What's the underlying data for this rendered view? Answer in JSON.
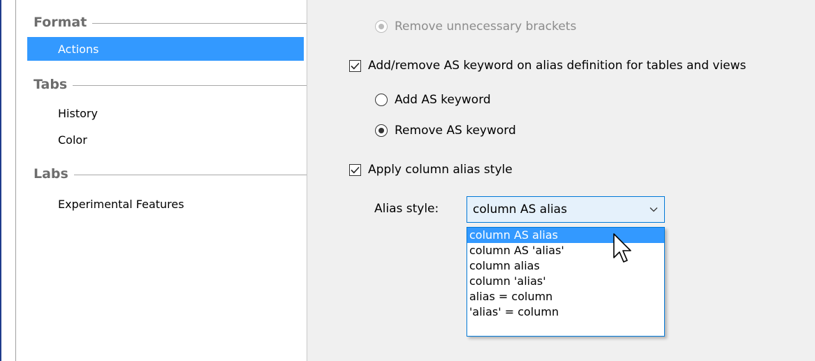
{
  "sidebar": {
    "sections": [
      {
        "title": "Format",
        "items": [
          {
            "label": "Actions",
            "selected": true
          }
        ]
      },
      {
        "title": "Tabs",
        "items": [
          {
            "label": "History",
            "selected": false
          },
          {
            "label": "Color",
            "selected": false
          }
        ]
      },
      {
        "title": "Labs",
        "items": [
          {
            "label": "Experimental Features",
            "selected": false
          }
        ]
      }
    ]
  },
  "content": {
    "remove_brackets": {
      "label": "Remove unnecessary brackets",
      "checked": true,
      "enabled": false
    },
    "as_keyword": {
      "label": "Add/remove AS keyword on alias definition for tables and views",
      "checked": true,
      "options": [
        {
          "label": "Add AS keyword",
          "selected": false
        },
        {
          "label": "Remove AS keyword",
          "selected": true
        }
      ]
    },
    "column_alias": {
      "label": "Apply column alias style",
      "checked": true
    },
    "alias_style": {
      "label": "Alias style:",
      "value": "column AS alias",
      "options": [
        "column AS alias",
        "column AS 'alias'",
        "column alias",
        "column 'alias'",
        "alias = column",
        "'alias' = column"
      ],
      "highlighted_index": 0
    }
  },
  "icons": {
    "checkbox_check": "check-icon",
    "combo_chevron": "chevron-down-icon",
    "cursor": "mouse-pointer-icon"
  },
  "colors": {
    "selection": "#3399ff",
    "focus_border": "#0078d7",
    "combo_bg": "#e5f1fb",
    "panel_bg": "#f0f0f0",
    "section_header": "#6d6d6d"
  }
}
